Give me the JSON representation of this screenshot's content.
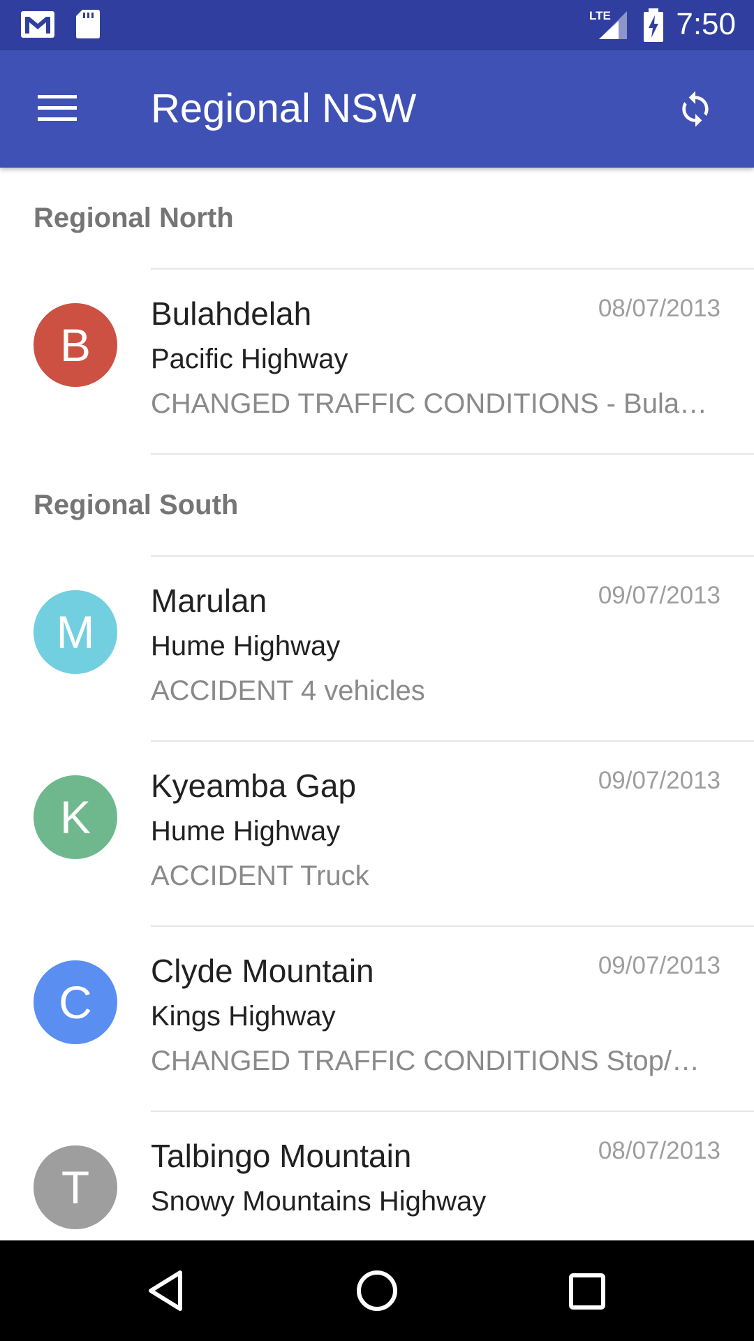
{
  "status_bar": {
    "time": "7:50",
    "network": "LTE",
    "icons": [
      "gmail-icon",
      "sd-card-icon",
      "lte-signal-icon",
      "battery-charging-icon"
    ]
  },
  "app_bar": {
    "title": "Regional NSW",
    "menu_icon": "hamburger-menu-icon",
    "refresh_icon": "refresh-icon"
  },
  "sections": [
    {
      "header": "Regional North",
      "items": [
        {
          "letter": "B",
          "title": "Bulahdelah",
          "date": "08/07/2013",
          "road": "Pacific Highway",
          "description": "CHANGED TRAFFIC CONDITIONS - Bulahdelah",
          "color": "#cc5142"
        }
      ]
    },
    {
      "header": "Regional South",
      "items": [
        {
          "letter": "M",
          "title": "Marulan",
          "date": "09/07/2013",
          "road": "Hume Highway",
          "description": "ACCIDENT 4 vehicles",
          "color": "#71cfe0"
        },
        {
          "letter": "K",
          "title": "Kyeamba Gap",
          "date": "09/07/2013",
          "road": "Hume Highway",
          "description": "ACCIDENT Truck",
          "color": "#6fb88d"
        },
        {
          "letter": "C",
          "title": "Clyde Mountain",
          "date": "09/07/2013",
          "road": "Kings Highway",
          "description": "CHANGED TRAFFIC CONDITIONS Stop/Slow",
          "color": "#5a8ef0"
        },
        {
          "letter": "T",
          "title": "Talbingo Mountain",
          "date": "08/07/2013",
          "road": "Snowy Mountains Highway",
          "description": "",
          "color": "#9e9e9e"
        }
      ]
    }
  ],
  "nav_bar": {
    "icons": [
      "back-icon",
      "home-icon",
      "recents-icon"
    ]
  }
}
